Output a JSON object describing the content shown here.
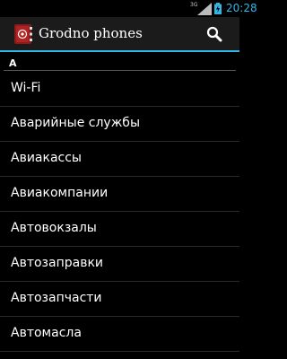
{
  "status_bar": {
    "network_label": "3G",
    "time": "20:28",
    "icons": [
      "signal-icon",
      "battery-icon"
    ],
    "clock_color": "#33b5e5"
  },
  "action_bar": {
    "title": "Grodno phones",
    "app_icon": "address-book-icon",
    "search_icon": "search-icon",
    "accent_color": "#33b5e5"
  },
  "section": {
    "letter": "A"
  },
  "list": {
    "items": [
      "Wi-Fi",
      "Аварийные службы",
      "Авиакассы",
      "Авиакомпании",
      "Автовокзалы",
      "Автозаправки",
      "Автозапчасти",
      "Автомасла"
    ]
  }
}
